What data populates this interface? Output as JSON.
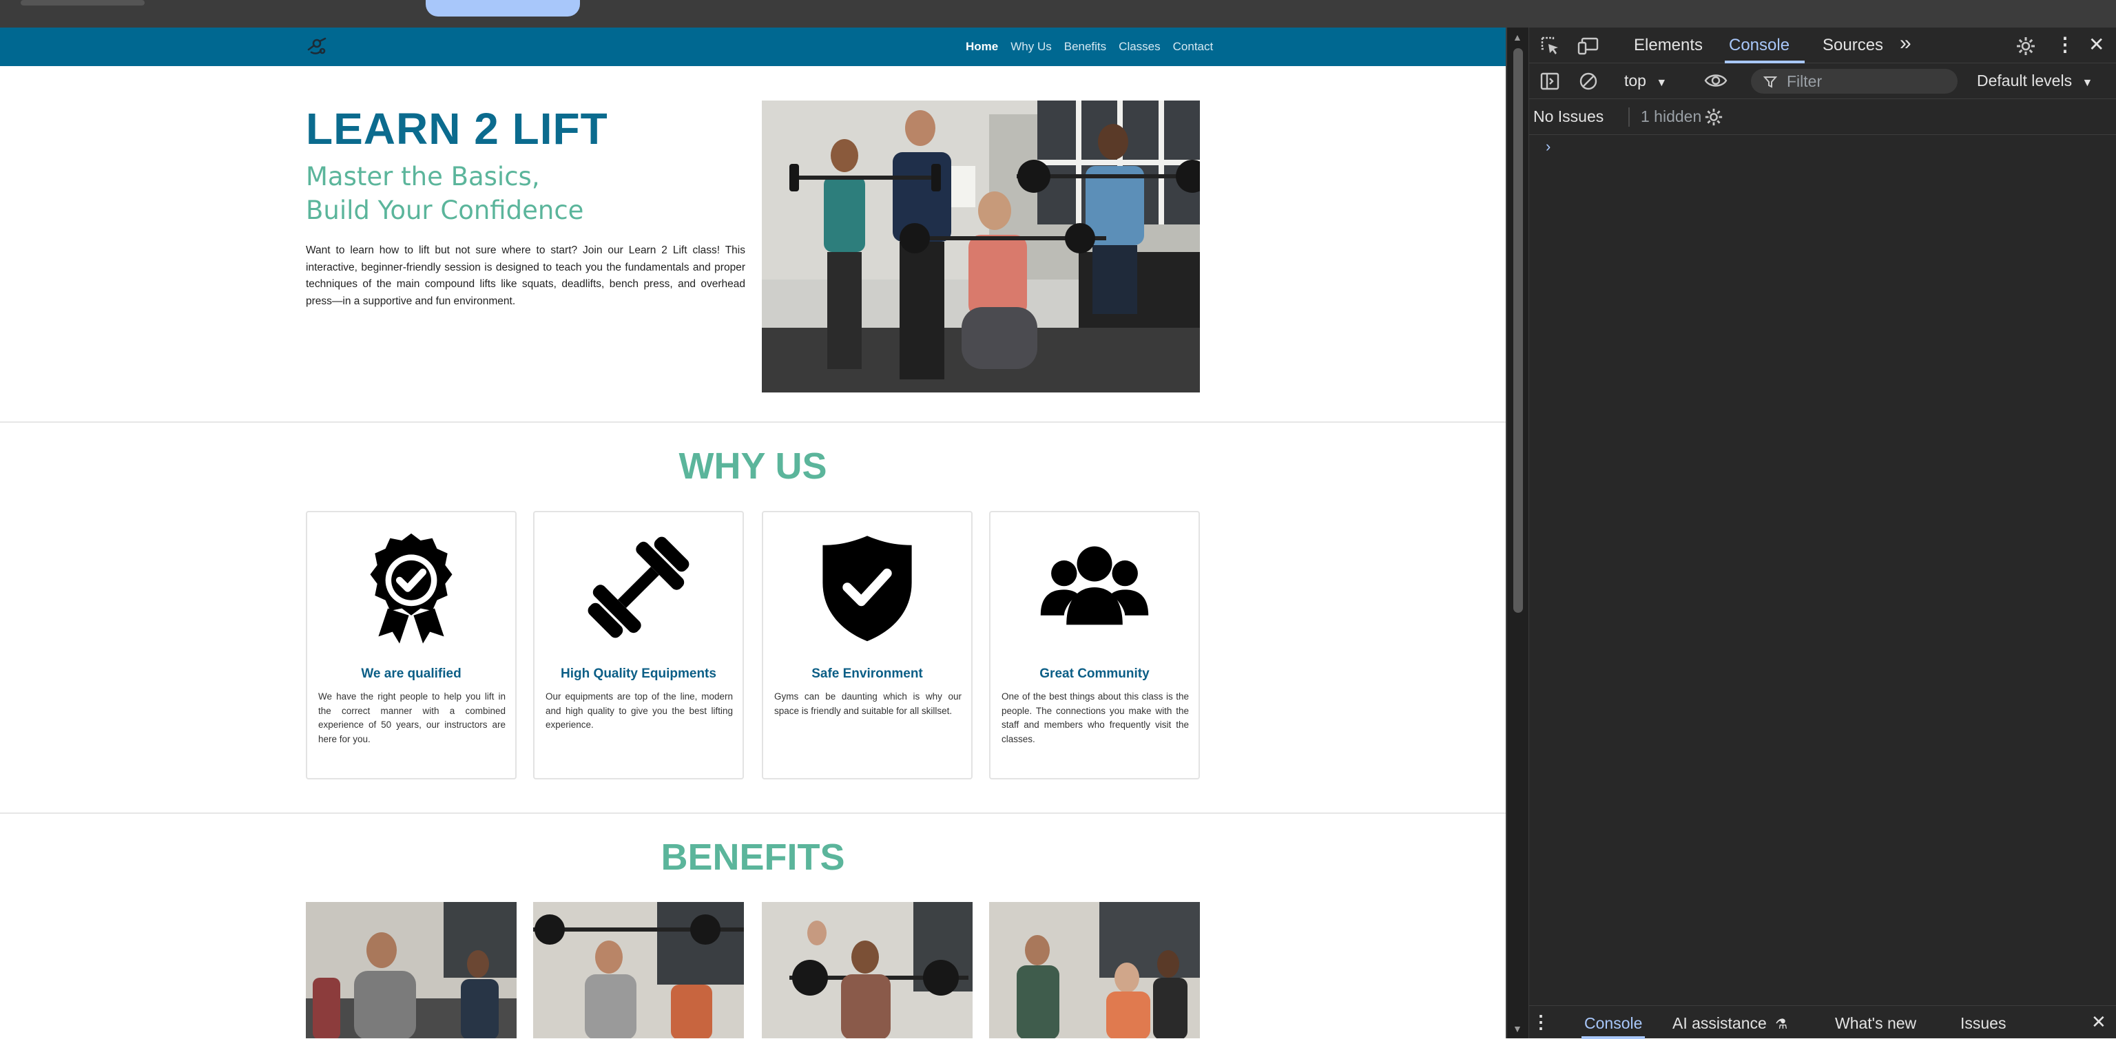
{
  "nav": {
    "logo_icon": "lifting-logo-icon",
    "links": [
      "Home",
      "Why Us",
      "Benefits",
      "Classes",
      "Contact"
    ],
    "active": "Home"
  },
  "hero": {
    "title": "LEARN 2 LIFT",
    "subtitle_line1": "Master the Basics,",
    "subtitle_line2": "Build Your Confidence",
    "text": "Want to learn how to lift but not sure where to start? Join our Learn 2 Lift class! This interactive, beginner-friendly session is designed to teach you the fundamentals and proper techniques of the main compound lifts like squats, deadlifts, bench press, and overhead press—in a supportive and fun environment."
  },
  "why_us": {
    "title": "WHY US",
    "cards": [
      {
        "icon": "award-badge-icon",
        "title": "We are qualified",
        "text": "We have the right people to help you lift in the correct manner with a combined experience of 50 years, our instructors are here for you."
      },
      {
        "icon": "dumbbell-icon",
        "title": "High Quality Equipments",
        "text": "Our equipments are top of the line, modern and high quality to give you the best lifting experience."
      },
      {
        "icon": "shield-check-icon",
        "title": "Safe Environment",
        "text": "Gyms can be daunting which is why our space is friendly and suitable for all skillset."
      },
      {
        "icon": "users-icon",
        "title": "Great Community",
        "text": "One of the best things about this class is the people. The connections you make with the staff and members who frequently visit the classes."
      }
    ]
  },
  "benefits": {
    "title": "BENEFITS"
  },
  "devtools": {
    "tabs": [
      "Elements",
      "Console",
      "Sources"
    ],
    "active_tab": "Console",
    "context": "top",
    "filter_placeholder": "Filter",
    "levels": "Default levels",
    "issues": "No Issues",
    "hidden": "1 hidden",
    "drawer_tabs": [
      "Console",
      "AI assistance",
      "What's new",
      "Issues"
    ],
    "colors": {
      "accent": "#a8c7fa",
      "bg": "#282828"
    }
  },
  "colors": {
    "nav": "#006891",
    "title": "#0b6b8e",
    "accent_green": "#5bb59b"
  }
}
